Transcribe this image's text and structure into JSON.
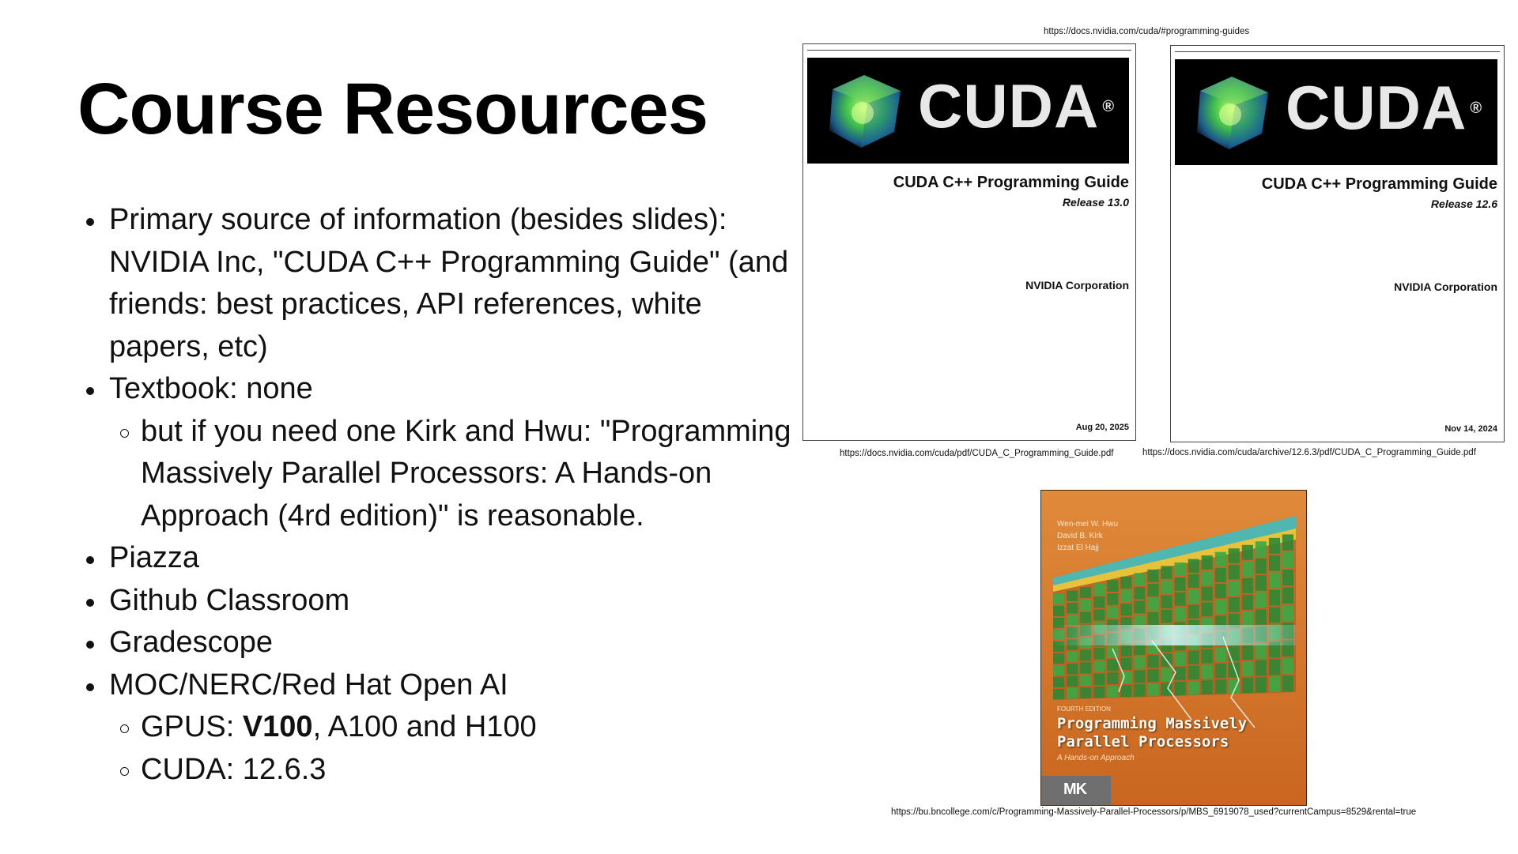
{
  "slide": {
    "title": "Course Resources",
    "bullets": {
      "b1": "Primary source of information (besides slides): NVIDIA Inc, \"CUDA C++ Programming Guide\" (and friends: best practices, API references, white papers, etc)",
      "b2": "Textbook: none",
      "b2_sub": "but if you need one Kirk and Hwu: \"Programming Massively Parallel Processors: A Hands-on Approach (4rd edition)\" is reasonable.",
      "b3": "Piazza",
      "b4": "Github Classroom",
      "b5": "Gradescope",
      "b6": "MOC/NERC/Red Hat Open AI",
      "b6_sub1_prefix": "GPUS: ",
      "b6_sub1_bold": "V100",
      "b6_sub1_rest": ", A100 and H100",
      "b6_sub2": "CUDA: 12.6.3"
    }
  },
  "links": {
    "top": "https://docs.nvidia.com/cuda/#programming-guides",
    "guide_current": "https://docs.nvidia.com/cuda/pdf/CUDA_C_Programming_Guide.pdf",
    "guide_archive": "https://docs.nvidia.com/cuda/archive/12.6.3/pdf/CUDA_C_Programming_Guide.pdf",
    "book": "https://bu.bncollege.com/c/Programming-Massively-Parallel-Processors/p/MBS_6919078_used?currentCampus=8529&rental=true"
  },
  "covers": [
    {
      "logo": "CUDA",
      "reg": "®",
      "title": "CUDA C++ Programming Guide",
      "release": "Release 13.0",
      "publisher": "NVIDIA Corporation",
      "date": "Aug 20, 2025"
    },
    {
      "logo": "CUDA",
      "reg": "®",
      "title": "CUDA C++ Programming Guide",
      "release": "Release 12.6",
      "publisher": "NVIDIA Corporation",
      "date": "Nov 14, 2024"
    }
  ],
  "book": {
    "authors": [
      "Wen-mei W. Hwu",
      "David B. Kirk",
      "Izzat El Hajj"
    ],
    "edition": "FOURTH EDITION",
    "title_line1": "Programming Massively",
    "title_line2": "Parallel Processors",
    "subtitle": "A Hands-on Approach",
    "publisher_logo": "MK"
  },
  "colors": {
    "book_orange": "#d9782a",
    "book_teal": "#4fb7b0",
    "grid_green": "#2f9a3a",
    "cuda_banner": "#000000"
  }
}
